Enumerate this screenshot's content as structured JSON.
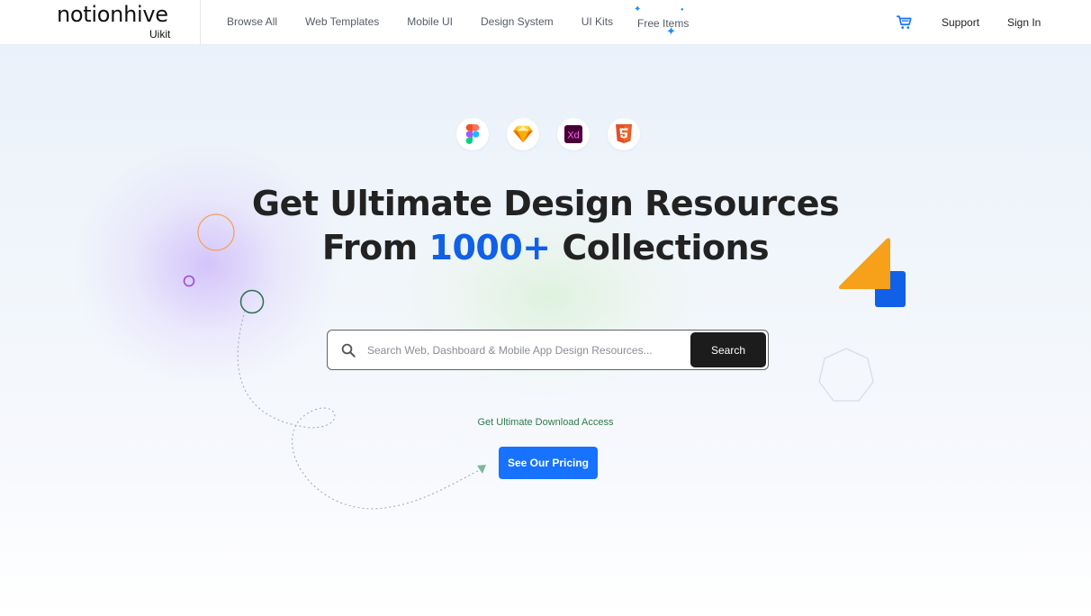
{
  "header": {
    "logo": "notionhive",
    "logo_sub": "Uikit",
    "nav": [
      "Browse All",
      "Web Templates",
      "Mobile UI",
      "Design System",
      "UI Kits"
    ],
    "free_items": "Free Items",
    "support": "Support",
    "sign_in": "Sign In",
    "cart_icon": "cart-icon"
  },
  "hero": {
    "tool_icons": [
      "figma-icon",
      "sketch-icon",
      "xd-icon",
      "html5-icon"
    ],
    "xd_text": "Xd",
    "headline_line1": "Get Ultimate Design Resources",
    "headline_from": "From ",
    "headline_count": "1000+",
    "headline_rest": " Collections",
    "search_placeholder": "Search Web, Dashboard & Mobile App Design Resources...",
    "search_button": "Search",
    "access_text": "Get Ultimate Download Access",
    "pricing_button": "See Our Pricing"
  },
  "colors": {
    "accent_blue": "#1060e8",
    "button_blue": "#1672ff",
    "search_button": "#1c1c1c",
    "access_green": "#2f7a4c",
    "orange": "#f7a01a"
  }
}
